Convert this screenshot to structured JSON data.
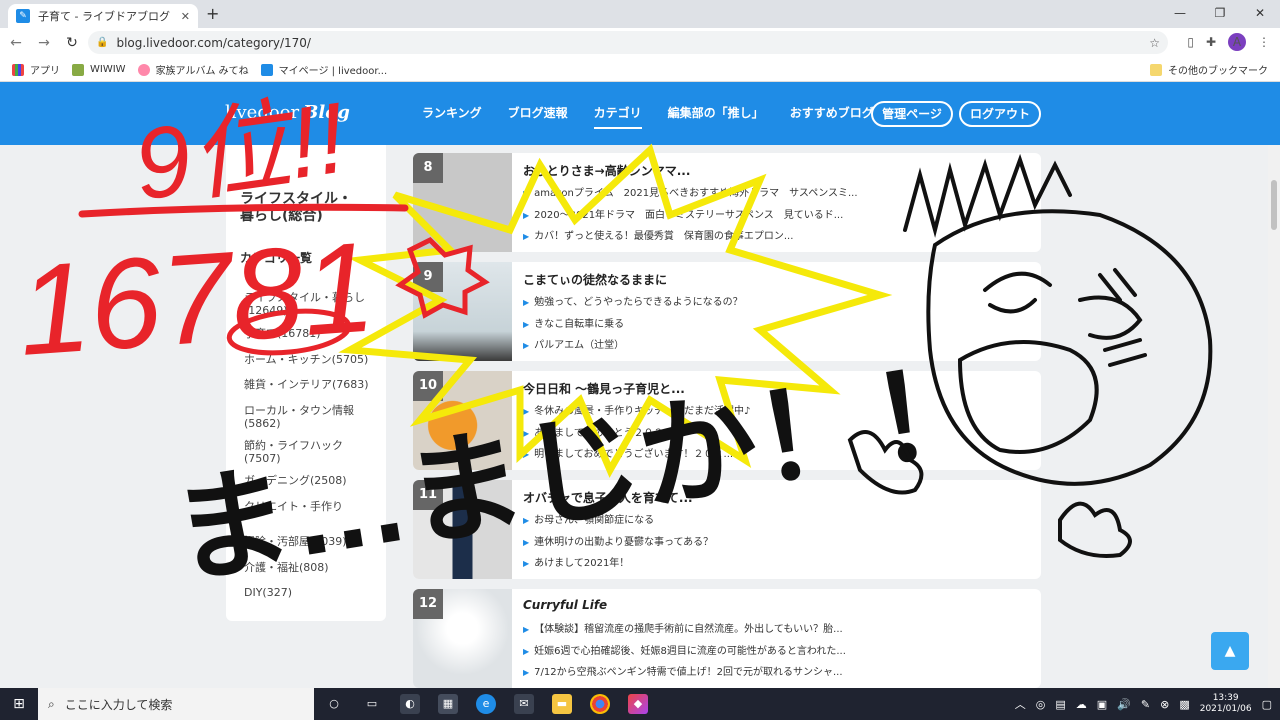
{
  "browser": {
    "tab_title": "子育て - ライブドアブログ",
    "url": "blog.livedoor.com/category/170/",
    "bookmarks": [
      "アプリ",
      "WIWIW",
      "家族アルバム みてね",
      "マイページ | livedoor..."
    ],
    "other_bookmarks": "その他のブックマーク",
    "profile_initial": "A"
  },
  "header": {
    "logo": "livedoor",
    "logo_sub": "Blog",
    "nav": [
      "ランキング",
      "ブログ速報",
      "カテゴリ",
      "編集部の「推し」",
      "おすすめブログ"
    ],
    "admin_button": "管理ページ",
    "logout_button": "ログアウト"
  },
  "sidebar": {
    "title": "ライフスタイル・暮らし(総合)",
    "subtitle": "カテゴリ一覧",
    "items": [
      "ライフスタイル・暮らし(12649)",
      "子育て(16781)",
      "ホーム・キッチン(5705)",
      "雑貨・インテリア(7683)",
      "ローカル・タウン情報(5862)",
      "節約・ライフハック(7507)",
      "ガーデニング(2508)",
      "クリエイト・手作り",
      "掃除・汚部屋(1039)",
      "介護・福祉(808)",
      "DIY(327)"
    ]
  },
  "ranking": [
    {
      "rank": "8",
      "blog": "おひとりさま→高齢シンママ...",
      "entries": [
        "amazonプライム　2021見るべきおすすめ海外ドラマ　サスペンスミ...",
        "2020～2021年ドラマ　面白いミステリーサスペンス　見ているド...",
        "カバ！ずっと使える！最優秀賞　保育園の食事エプロン..."
      ]
    },
    {
      "rank": "9",
      "blog": "こまてぃの徒然なるままに",
      "entries": [
        "勉強って、どうやったらできるようになるの？",
        "きなこ自転車に乗る",
        "パルアエム（辻堂）"
      ]
    },
    {
      "rank": "10",
      "blog": "今日日和 〜鶴見っ子育児と...",
      "entries": [
        "冬休みの風景・手作りキッチンまだまだ活躍中♪",
        "あけましておめでとう２０２１",
        "明けましておめでとうございます！２０２..."
      ]
    },
    {
      "rank": "11",
      "blog": "オバチャで息子２人を育てて...",
      "entries": [
        "お母さん、顎関節症になる",
        "連休明けの出勤より憂鬱な事ってある？",
        "あけまして2021年！"
      ]
    },
    {
      "rank": "12",
      "blog": "Curryful Life",
      "entries": [
        "【体験談】稽留流産の掻爬手術前に自然流産。外出してもいい？胎...",
        "妊娠6週で心拍確認後、妊娠8週目に流産の可能性があると言われた...",
        "7/12から空飛ぶペンギン特需で値上げ！2回で元が取れるサンシャ..."
      ]
    }
  ],
  "doodle": {
    "rank_text": "9位!!",
    "count_text": "16781",
    "exclaim": "ま…まじか！！"
  },
  "taskbar": {
    "search_placeholder": "ここに入力して検索",
    "time": "13:39",
    "date": "2021/01/06"
  },
  "colors": {
    "brand": "#1f8ce6",
    "marker_red": "#e8242a",
    "highlighter_yellow": "#f5e90a"
  }
}
